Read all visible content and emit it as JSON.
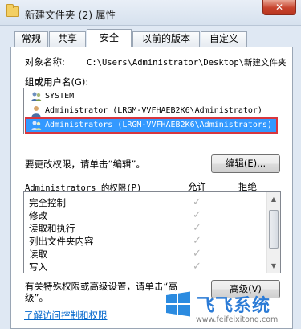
{
  "window": {
    "title": "新建文件夹 (2) 属性",
    "close_label": "✕"
  },
  "tabs": [
    {
      "label": "常规"
    },
    {
      "label": "共享"
    },
    {
      "label": "安全",
      "active": true
    },
    {
      "label": "以前的版本"
    },
    {
      "label": "自定义"
    }
  ],
  "object_name": {
    "label": "对象名称:",
    "value": "C:\\Users\\Administrator\\Desktop\\新建文件夹"
  },
  "group_label": "组或用户名(G):",
  "users": [
    {
      "icon": "users-icon",
      "name": "SYSTEM"
    },
    {
      "icon": "user-icon",
      "name": "Administrator (LRGM-VVFHAEB2K6\\Administrator)"
    },
    {
      "icon": "users-icon",
      "name": "Administrators (LRGM-VVFHAEB2K6\\Administrators)",
      "selected": true
    }
  ],
  "change_perm_text": "要更改权限，请单击“编辑”。",
  "edit_button": "编辑(E)...",
  "perm_header": {
    "title": "Administrators 的权限(P)",
    "allow": "允许",
    "deny": "拒绝"
  },
  "permissions": [
    {
      "name": "完全控制",
      "allow": true
    },
    {
      "name": "修改",
      "allow": true
    },
    {
      "name": "读取和执行",
      "allow": true
    },
    {
      "name": "列出文件夹内容",
      "allow": true
    },
    {
      "name": "读取",
      "allow": true
    },
    {
      "name": "写入",
      "allow": true
    }
  ],
  "check_glyph": "✓",
  "special_text_1": "有关特殊权限或高级设置，请单击“高",
  "special_text_2": "级”。",
  "advanced_button": "高级(V)",
  "learn_link": "了解访问控制和权限",
  "watermark": {
    "text": "飞飞系统",
    "url": "www.feifeixitong.com"
  },
  "colors": {
    "selection": "#3399ff",
    "highlight_border": "#d9363e",
    "link": "#0066cc"
  }
}
